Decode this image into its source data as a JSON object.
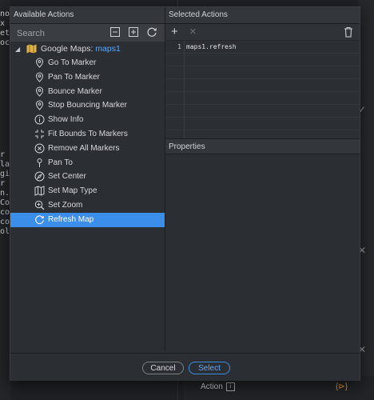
{
  "background": {
    "code_lines": [
      "nod",
      "x",
      "et",
      "oc",
      "",
      "",
      "",
      "r a",
      "la",
      "gi",
      "r a",
      "n.",
      "Co",
      "con",
      "co",
      "ol"
    ],
    "action_label": "Action",
    "widget_label": "{⊳}"
  },
  "left_panel": {
    "title": "Available Actions",
    "search_placeholder": "Search",
    "root": {
      "label": "Google Maps: ",
      "id": "maps1"
    },
    "items": [
      {
        "label": "Go To Marker",
        "icon": "pin-icon"
      },
      {
        "label": "Pan To Marker",
        "icon": "pin-icon"
      },
      {
        "label": "Bounce Marker",
        "icon": "pin-icon"
      },
      {
        "label": "Stop Bouncing Marker",
        "icon": "pin-icon"
      },
      {
        "label": "Show Info",
        "icon": "info-icon"
      },
      {
        "label": "Fit Bounds To Markers",
        "icon": "fit-bounds-icon"
      },
      {
        "label": "Remove All Markers",
        "icon": "remove-icon"
      },
      {
        "label": "Pan To",
        "icon": "pushpin-icon"
      },
      {
        "label": "Set Center",
        "icon": "compass-icon"
      },
      {
        "label": "Set Map Type",
        "icon": "map-icon"
      },
      {
        "label": "Set Zoom",
        "icon": "zoom-icon"
      },
      {
        "label": "Refresh Map",
        "icon": "refresh-icon"
      }
    ],
    "selected_index": 11
  },
  "right_panel": {
    "title": "Selected Actions",
    "lines": [
      {
        "num": "1",
        "code": "maps1.refresh"
      }
    ],
    "properties_title": "Properties"
  },
  "footer": {
    "cancel_label": "Cancel",
    "select_label": "Select"
  },
  "colors": {
    "accent": "#3b8eea",
    "link": "#5aa9ff"
  }
}
